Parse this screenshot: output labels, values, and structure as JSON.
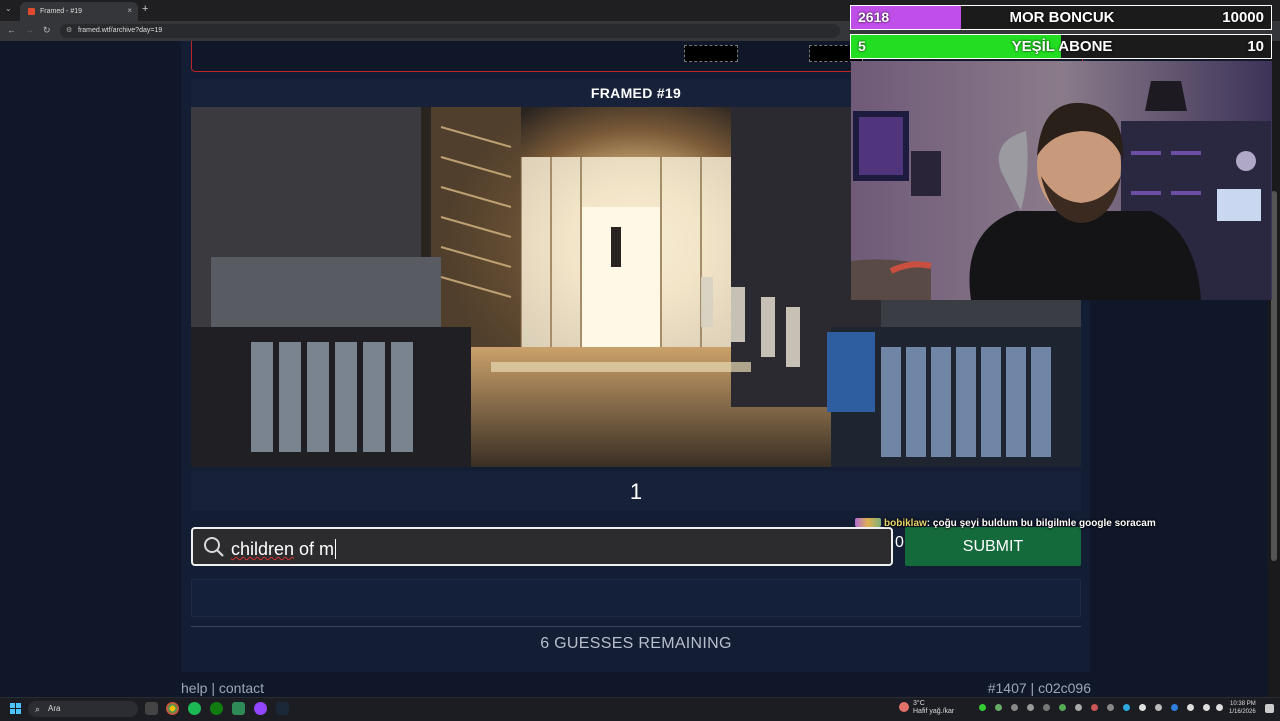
{
  "browser": {
    "tab_title": "Framed - #19",
    "tab_close": "×",
    "new_tab": "+",
    "url": "framed.wtf/archive?day=19"
  },
  "game": {
    "title": "FRAMED #19",
    "frame_number": "1",
    "search_value_underlined": "children",
    "search_value_rest": " of m",
    "partial_digit": "0",
    "submit_label": "SUBMIT",
    "remaining": "6 GUESSES REMAINING",
    "footer_help": "help",
    "footer_sep": " | ",
    "footer_contact": "contact",
    "footer_id": "#1407 | c02c096"
  },
  "overlay": {
    "goals": [
      {
        "current": "2618",
        "name": "MOR BONCUK",
        "target": "10000",
        "progress": 0.2618,
        "color": "#c04ee8"
      },
      {
        "current": "5",
        "name": "YEŞİL ABONE",
        "target": "10",
        "progress": 0.5,
        "color": "#22dd22"
      }
    ],
    "chat": {
      "user": "bobiklaw",
      "message": ": çoğu şeyi buldum bu bilgilmle google soracam"
    }
  },
  "taskbar": {
    "search_label": "Ara",
    "weather_temp": "3°C",
    "weather_desc": "Hafif yağ./kar",
    "time": "10:38 PM",
    "date": "1/16/2026"
  },
  "colors": {
    "page_bg": "#0f1729",
    "panel_bg": "#131d33",
    "submit_green": "#156a3c",
    "border_red": "#b8262b"
  }
}
